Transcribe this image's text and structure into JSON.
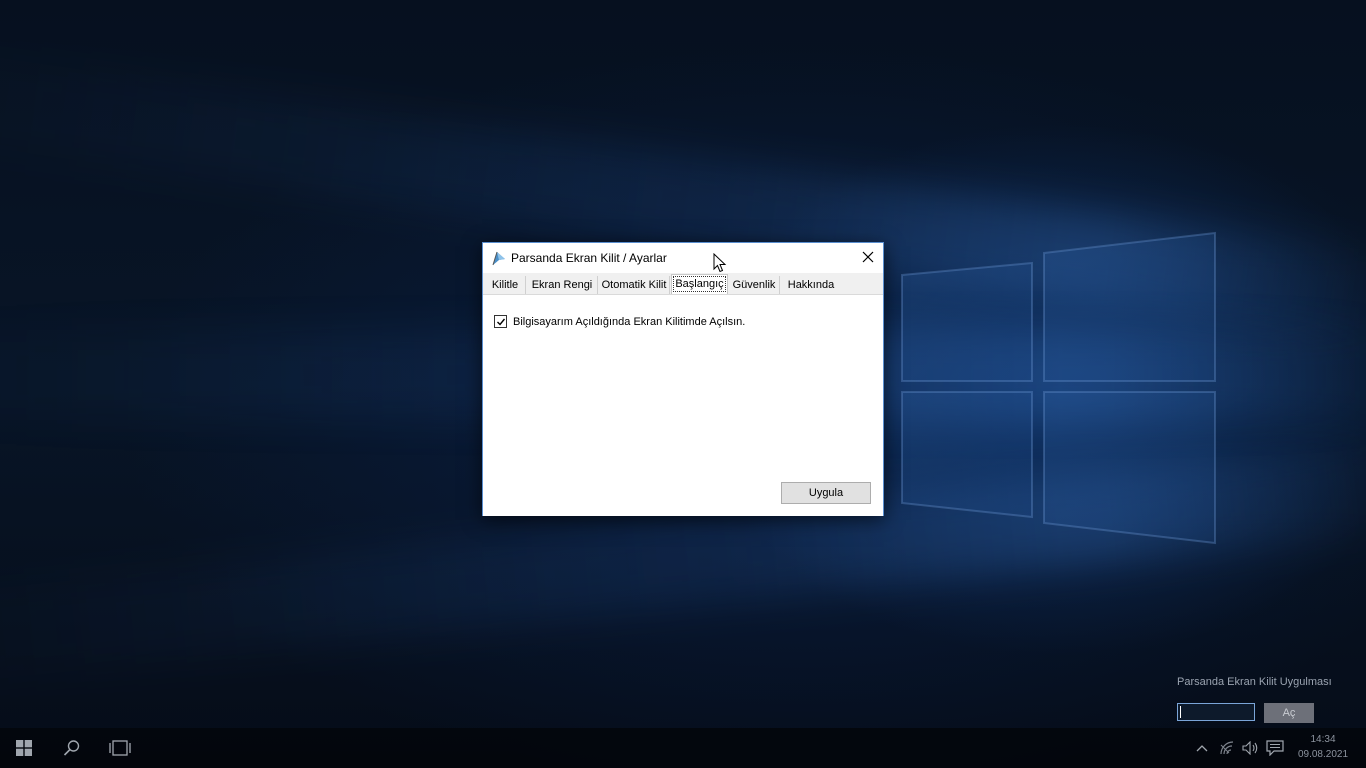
{
  "dialog": {
    "title": "Parsanda Ekran Kilit / Ayarlar",
    "tabs": [
      {
        "label": "Kilitle"
      },
      {
        "label": "Ekran Rengi"
      },
      {
        "label": "Otomatik Kilit"
      },
      {
        "label": "Başlangıç"
      },
      {
        "label": "Güvenlik"
      },
      {
        "label": "Hakkında"
      }
    ],
    "active_tab": "Başlangıç",
    "startup_checkbox": {
      "label": "Bilgisayarım Açıldığında Ekran Kilitimde Açılsın.",
      "checked": true
    },
    "apply_button": "Uygula"
  },
  "mini_app": {
    "title": "Parsanda Ekran Kilit Uygulması",
    "input_value": "",
    "open_button": "Aç"
  },
  "taskbar": {
    "time": "14:34",
    "date": "09.08.2021",
    "icons": [
      "windows-start-icon",
      "search-icon",
      "task-view-icon"
    ],
    "tray_icons": [
      "chevron-up-icon",
      "network-icon",
      "volume-icon",
      "notification-icon"
    ]
  },
  "colors": {
    "accent": "#5a8fd0",
    "desktop": "#081527"
  }
}
